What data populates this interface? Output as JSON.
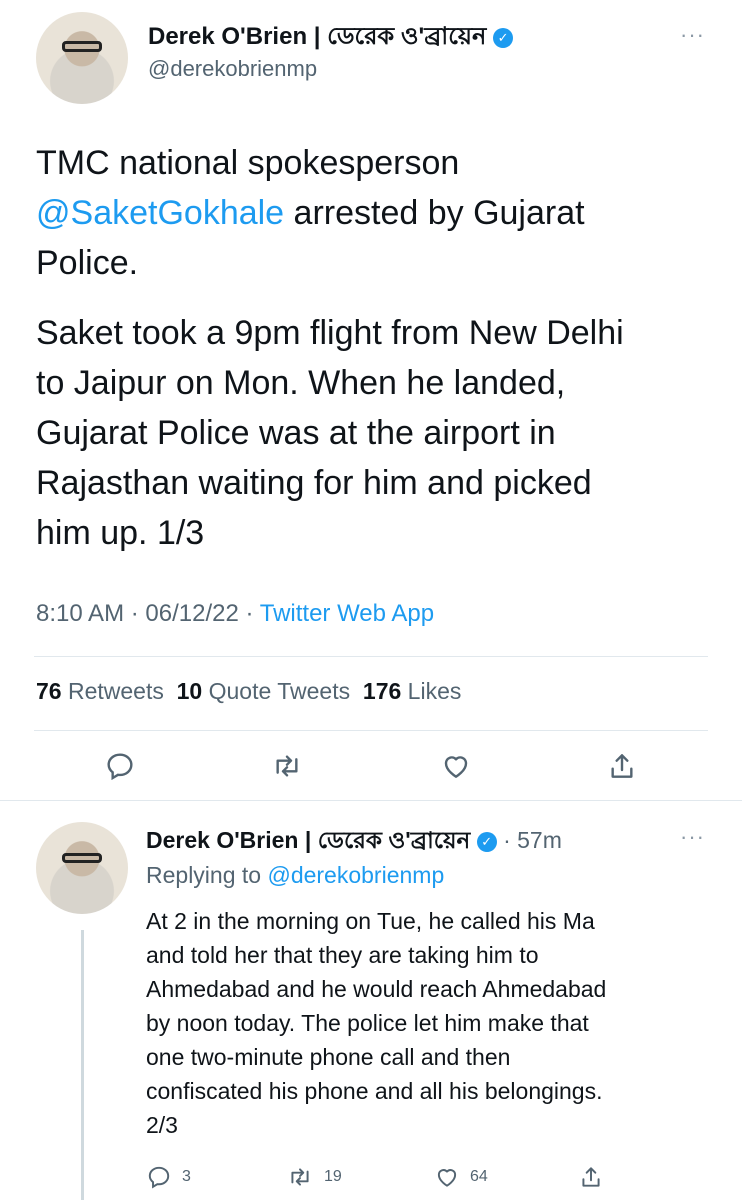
{
  "main_tweet": {
    "author_name": "Derek O'Brien | ডেরেক ও'ব্রায়েন",
    "author_handle": "@derekobrienmp",
    "text_line1": "TMC national spokesperson",
    "mention": "@SaketGokhale",
    "text_line2_rest": " arrested by Gujarat",
    "text_line3": "Police.",
    "paragraph2": [
      "Saket took a 9pm flight from New Delhi",
      "to Jaipur on Mon. When he landed,",
      "Gujarat Police was at the airport in",
      "Rajasthan waiting for him and picked",
      "him up. 1/3"
    ],
    "time": "8:10 AM",
    "date": "06/12/22",
    "source": "Twitter Web App",
    "retweets_count": "76",
    "retweets_label": "Retweets",
    "quote_count": "10",
    "quote_label": "Quote Tweets",
    "likes_count": "176",
    "likes_label": "Likes"
  },
  "reply_tweet": {
    "author_name": "Derek O'Brien | ডেরেক ও'ব্রায়েন",
    "age": "57m",
    "replying_prefix": "Replying to",
    "replying_handle": "@derekobrienmp",
    "lines": [
      "At 2 in the morning on Tue, he called his Ma",
      "and told her that they are taking him to",
      "Ahmedabad and he would reach Ahmedabad",
      "by noon today. The police let him make that",
      "one two-minute phone call and then",
      "confiscated his phone and all his belongings.",
      "2/3"
    ],
    "reply_count": "3",
    "retweet_count": "19",
    "like_count": "64"
  },
  "colors": {
    "accent": "#1d9bf0",
    "muted": "#536471",
    "text": "#0f1419"
  },
  "icons": [
    "verified-badge-icon",
    "more-icon",
    "reply-icon",
    "retweet-icon",
    "like-icon",
    "share-icon"
  ],
  "sep": "·"
}
